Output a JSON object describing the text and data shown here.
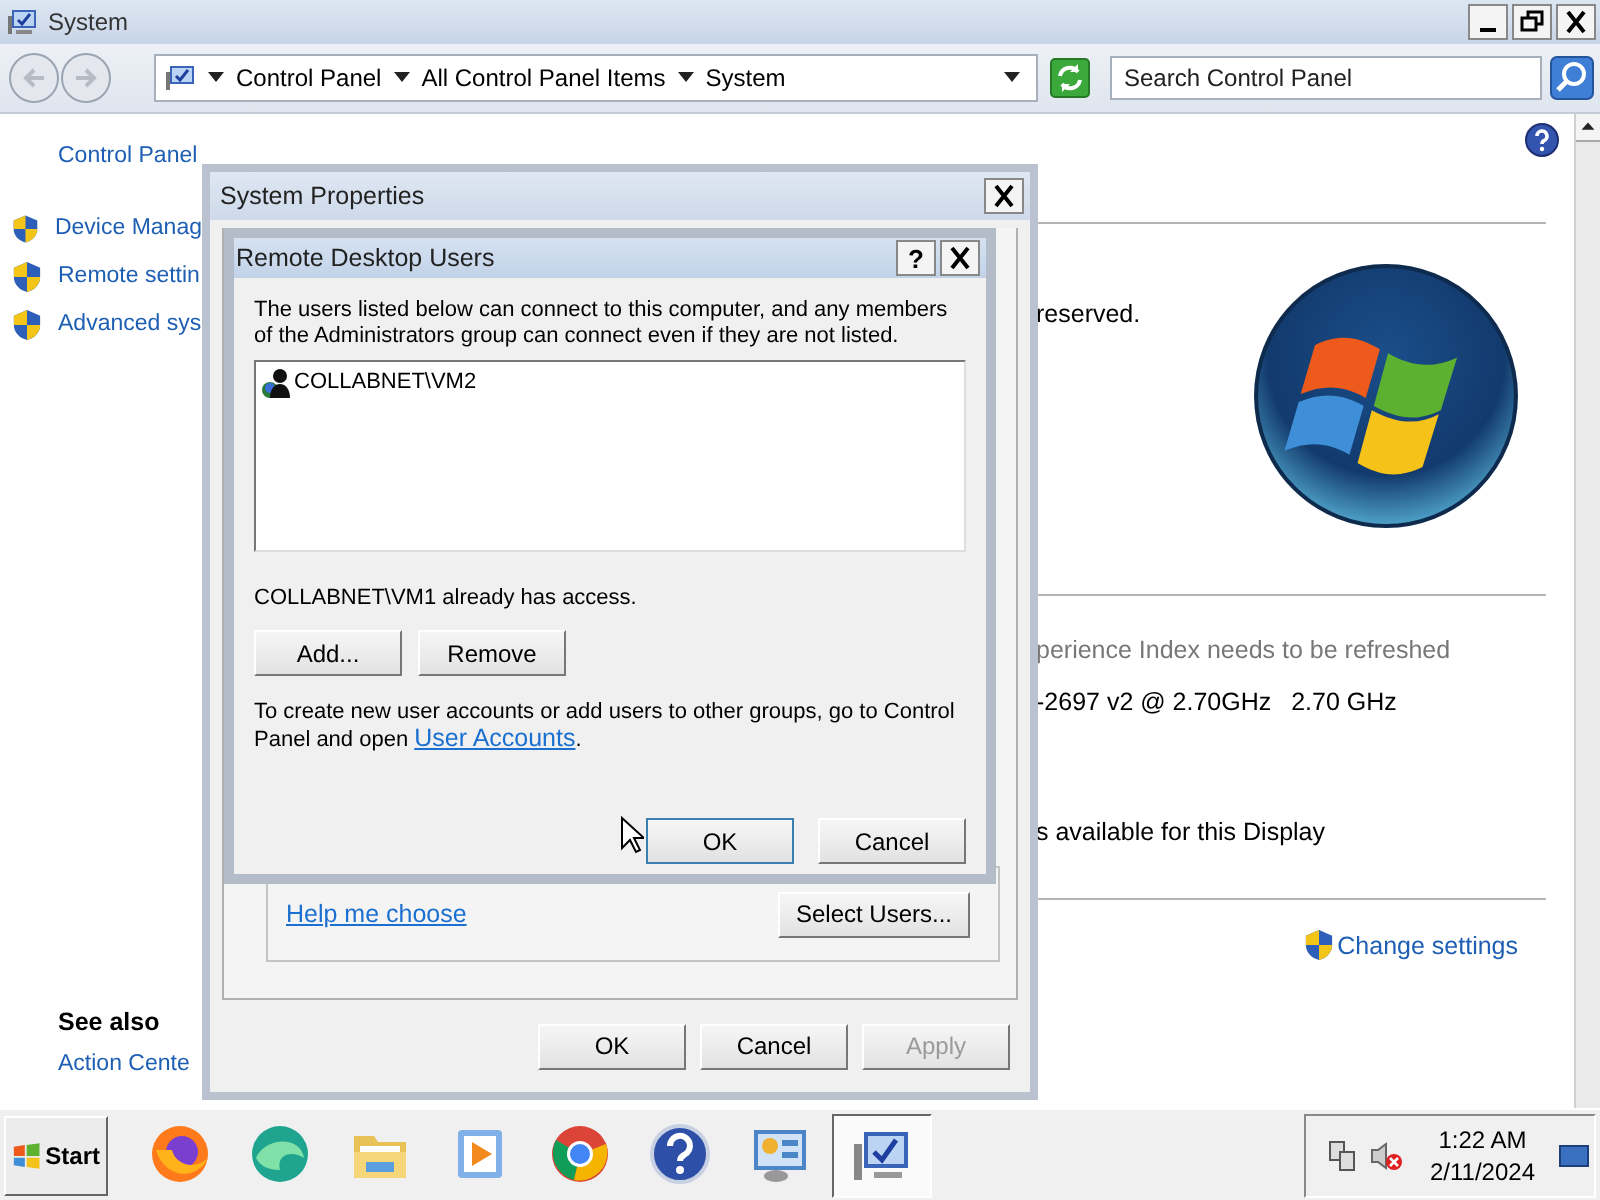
{
  "window": {
    "title": "System"
  },
  "address_bar": {
    "crumbs": [
      "Control Panel",
      "All Control Panel Items",
      "System"
    ]
  },
  "search": {
    "placeholder": "Search Control Panel"
  },
  "sidebar": {
    "home_link": "Control Panel",
    "tasks": [
      "Device Manag",
      "Remote settin",
      "Advanced sys"
    ],
    "see_also_title": "See also",
    "see_also": [
      "Action Cente"
    ]
  },
  "main": {
    "copyright_tail": "reserved.",
    "rating_notice": "perience Index needs to be refreshed",
    "processor": [
      "-2697 v2 @ 2.70GHz",
      "2.70 GHz"
    ],
    "pen_touch": "s available for this Display",
    "change_settings": "Change settings"
  },
  "system_properties": {
    "title": "System Properties",
    "help_link": "Help me choose",
    "select_users": "Select Users...",
    "buttons": [
      {
        "label": "OK",
        "disabled": false
      },
      {
        "label": "Cancel",
        "disabled": false
      },
      {
        "label": "Apply",
        "disabled": true
      }
    ]
  },
  "remote_desktop_users": {
    "title": "Remote Desktop Users",
    "help_button": "?",
    "intro": "The users listed below can connect to this computer, and any members of the Administrators group can connect even if they are not listed.",
    "users": [
      "COLLABNET\\VM2"
    ],
    "access_note": "COLLABNET\\VM1 already has access.",
    "list_buttons": [
      "Add...",
      "Remove"
    ],
    "footer_text": "To create new user accounts or add users to other groups, go to Control Panel and open ",
    "footer_link": "User Accounts",
    "footer_end": ".",
    "buttons": [
      "OK",
      "Cancel"
    ]
  },
  "taskbar": {
    "start": "Start",
    "apps": [
      {
        "kind": "firefox",
        "active": false
      },
      {
        "kind": "edge",
        "active": false
      },
      {
        "kind": "folder",
        "active": false
      },
      {
        "kind": "media",
        "active": false
      },
      {
        "kind": "chrome",
        "active": false
      },
      {
        "kind": "help",
        "active": false
      },
      {
        "kind": "control",
        "active": false
      },
      {
        "kind": "system",
        "active": true
      }
    ],
    "time": "1:22 AM",
    "date": "2/11/2024"
  }
}
